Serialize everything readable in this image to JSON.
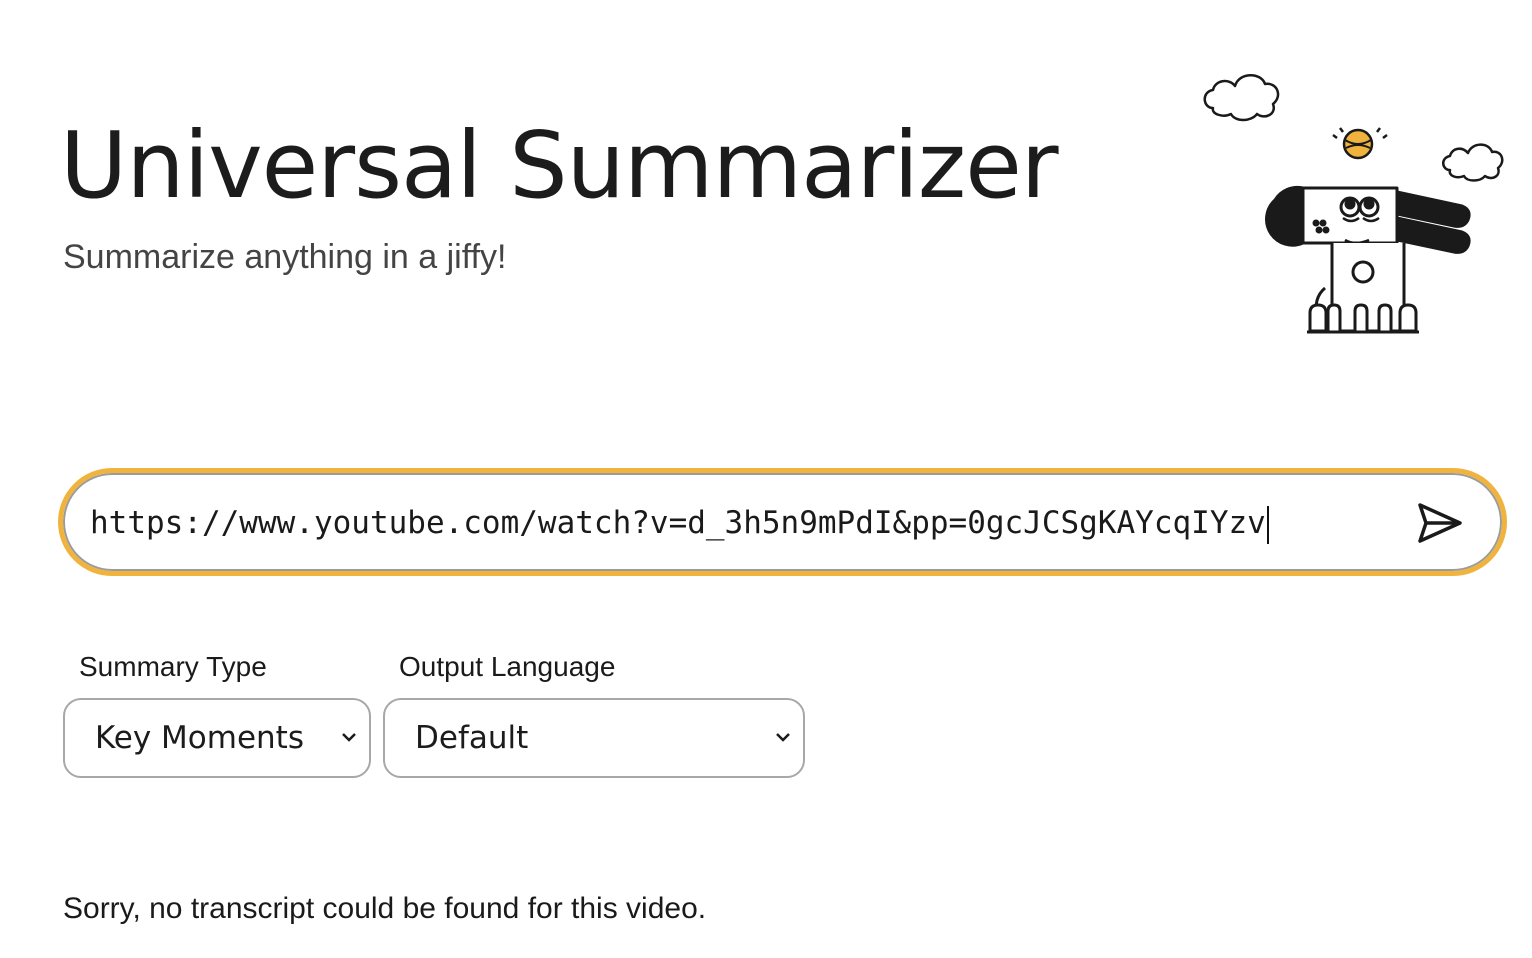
{
  "header": {
    "title": "Universal Summarizer",
    "subtitle": "Summarize anything in a jiffy!"
  },
  "illustration": {
    "icon": "dog-with-ball-and-clouds",
    "accent_color": "#f0b43e"
  },
  "url_bar": {
    "value": "https://www.youtube.com/watch?v=d_3h5n9mPdI&pp=0gcJCSgKAYcqIYzv",
    "focus_color": "#f0b43e",
    "submit_icon": "send-icon"
  },
  "summary_type": {
    "label": "Summary Type",
    "selected": "Key Moments"
  },
  "output_language": {
    "label": "Output Language",
    "selected": "Default"
  },
  "status": {
    "message": "Sorry, no transcript could be found for this video."
  }
}
